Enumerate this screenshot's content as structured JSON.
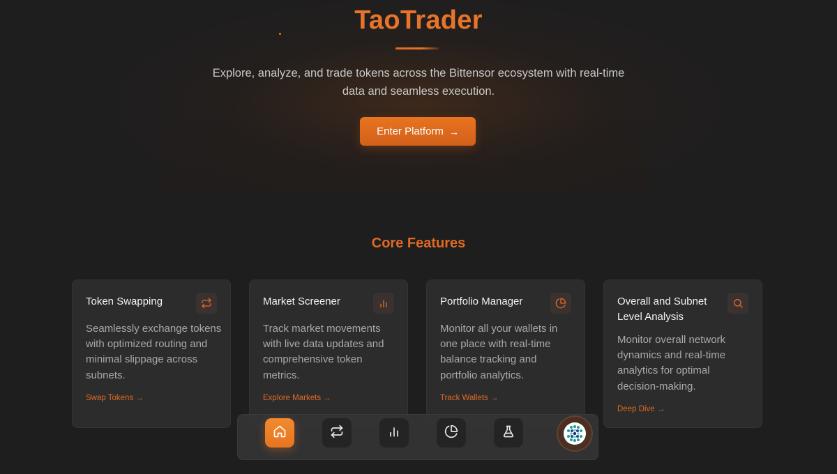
{
  "hero": {
    "title": "TaoTrader",
    "description": "Explore, analyze, and trade tokens across the Bittensor ecosystem with real-time data and seamless execution.",
    "cta_label": "Enter Platform",
    "cta_icon": "arrow-right-icon"
  },
  "features": {
    "section_title": "Core Features",
    "cards": [
      {
        "title": "Token Swapping",
        "description": "Seamlessly exchange tokens with optimized routing and minimal slippage across subnets.",
        "link_label": "Swap Tokens",
        "icon": "swap-arrows-icon"
      },
      {
        "title": "Market Screener",
        "description": "Track market movements with live data updates and comprehensive token metrics.",
        "link_label": "Explore Markets",
        "icon": "bar-chart-icon"
      },
      {
        "title": "Portfolio Manager",
        "description": "Monitor all your wallets in one place with real-time balance tracking and portfolio analytics.",
        "link_label": "Track Wallets",
        "icon": "pie-chart-icon"
      },
      {
        "title": "Overall and Subnet Level Analysis",
        "description": "Monitor overall network dynamics and real-time analytics for optimal decision-making.",
        "link_label": "Deep Dive",
        "icon": "search-icon"
      }
    ]
  },
  "dock": {
    "items": [
      {
        "icon": "home-icon",
        "active": true
      },
      {
        "icon": "swap-arrows-icon",
        "active": false
      },
      {
        "icon": "bar-chart-icon",
        "active": false
      },
      {
        "icon": "pie-chart-icon",
        "active": false
      },
      {
        "icon": "flask-icon",
        "active": false
      }
    ],
    "avatar_icon": "user-avatar-icon"
  },
  "colors": {
    "accent": "#e8742a",
    "background": "#1e1e1f",
    "card": "#2c2c2d",
    "muted_text": "#a9a9a9"
  }
}
